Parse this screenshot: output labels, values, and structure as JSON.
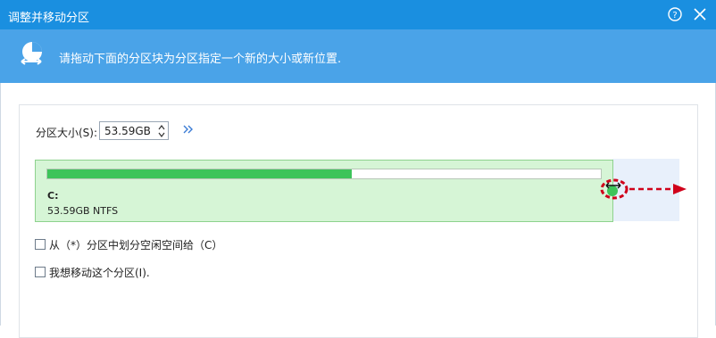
{
  "window": {
    "title": "调整并移动分区",
    "help_icon": "help-icon",
    "close_icon": "close-icon"
  },
  "banner": {
    "icon": "partition-move-icon",
    "text": "请拖动下面的分区块为分区指定一个新的大小或新位置."
  },
  "size": {
    "label": "分区大小(S):",
    "value": "53.59GB",
    "expand_icon": "double-chevron-right-icon"
  },
  "partition": {
    "letter": "C:",
    "info": "53.59GB NTFS",
    "used_fraction": 0.55,
    "colors": {
      "fill": "#3dc45a",
      "block": "#d6f5d6",
      "hint": "#d0021b"
    }
  },
  "options": [
    {
      "label": "从（*）分区中划分空闲空间给（C）",
      "checked": false
    },
    {
      "label": "我想移动这个分区(I).",
      "checked": false
    }
  ]
}
